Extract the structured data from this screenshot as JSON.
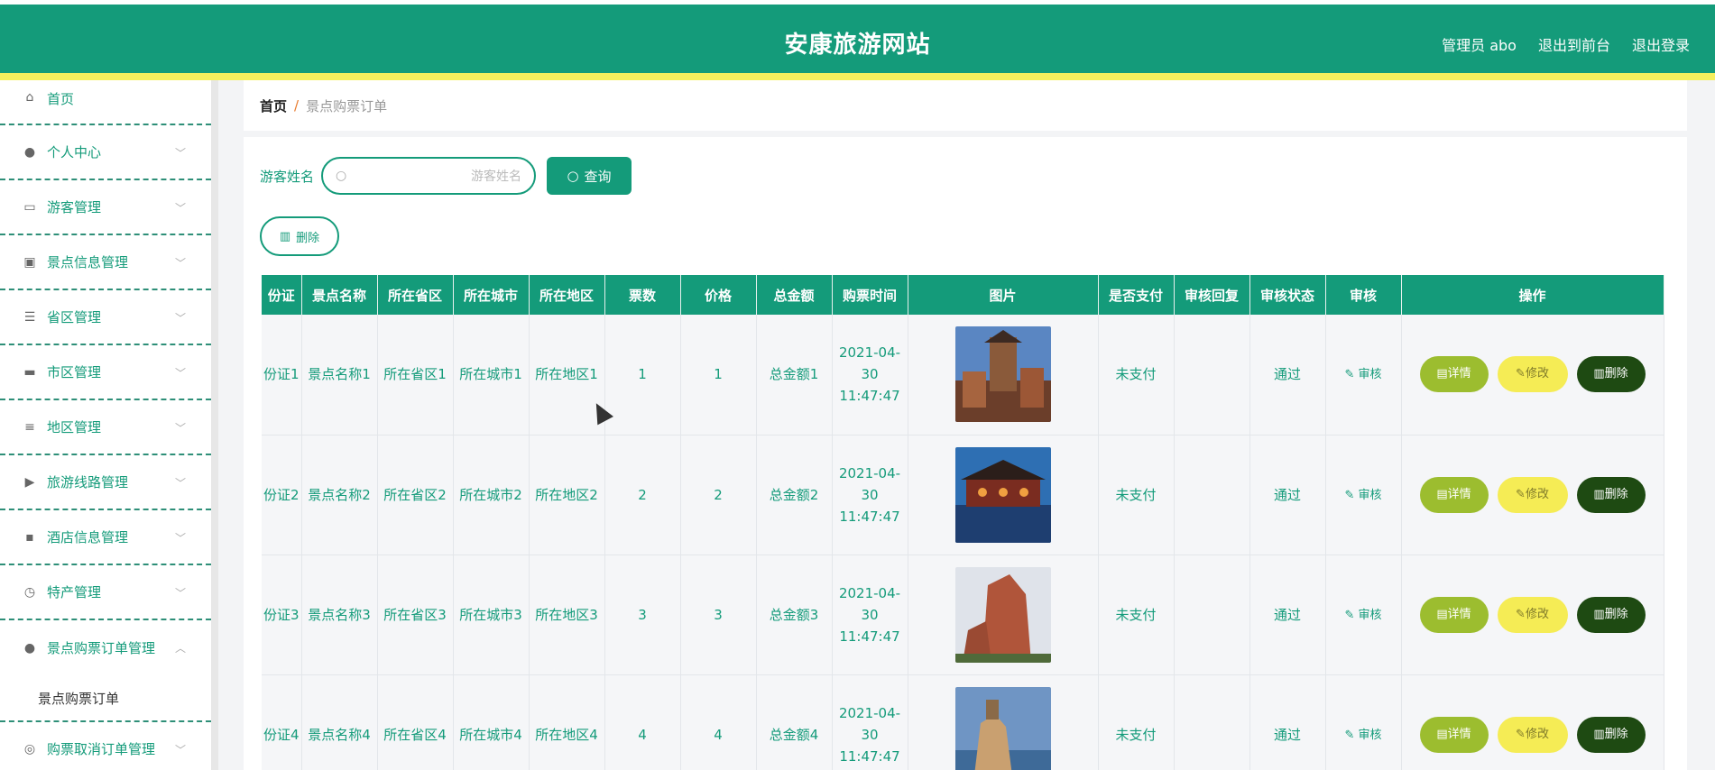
{
  "header": {
    "title": "安康旅游网站",
    "admin": "管理员 abo",
    "to_front": "退出到前台",
    "logout": "退出登录"
  },
  "sidebar": {
    "items": [
      {
        "label": "首页",
        "icon": "home-icon"
      },
      {
        "label": "个人中心",
        "icon": "user-icon"
      },
      {
        "label": "游客管理",
        "icon": "id-card-icon"
      },
      {
        "label": "景点信息管理",
        "icon": "clipboard-icon"
      },
      {
        "label": "省区管理",
        "icon": "list-icon"
      },
      {
        "label": "市区管理",
        "icon": "printer-icon"
      },
      {
        "label": "地区管理",
        "icon": "sliders-icon"
      },
      {
        "label": "旅游线路管理",
        "icon": "camera-icon"
      },
      {
        "label": "酒店信息管理",
        "icon": "chat-icon"
      },
      {
        "label": "特产管理",
        "icon": "clock-icon"
      },
      {
        "label": "景点购票订单管理",
        "icon": "user-icon"
      },
      {
        "label": "购票取消订单管理",
        "icon": "compass-icon"
      }
    ],
    "sub_active": "景点购票订单"
  },
  "breadcrumb": {
    "home": "首页",
    "sep": "/",
    "current": "景点购票订单"
  },
  "search": {
    "label": "游客姓名",
    "placeholder": "游客姓名",
    "button": "查询"
  },
  "toolbar": {
    "delete": "删除"
  },
  "table": {
    "headers": [
      "份证",
      "景点名称",
      "所在省区",
      "所在城市",
      "所在地区",
      "票数",
      "价格",
      "总金额",
      "购票时间",
      "图片",
      "是否支付",
      "审核回复",
      "审核状态",
      "审核",
      "操作"
    ],
    "rows": [
      {
        "id": "份证1",
        "name": "景点名称1",
        "province": "所在省区1",
        "city": "所在城市1",
        "area": "所在地区1",
        "tickets": "1",
        "price": "1",
        "total": "总金额1",
        "time": "2021-04-30 11:47:47",
        "paid": "未支付",
        "reply": "",
        "status": "通过"
      },
      {
        "id": "份证2",
        "name": "景点名称2",
        "province": "所在省区2",
        "city": "所在城市2",
        "area": "所在地区2",
        "tickets": "2",
        "price": "2",
        "total": "总金额2",
        "time": "2021-04-30 11:47:47",
        "paid": "未支付",
        "reply": "",
        "status": "通过"
      },
      {
        "id": "份证3",
        "name": "景点名称3",
        "province": "所在省区3",
        "city": "所在城市3",
        "area": "所在地区3",
        "tickets": "3",
        "price": "3",
        "total": "总金额3",
        "time": "2021-04-30 11:47:47",
        "paid": "未支付",
        "reply": "",
        "status": "通过"
      },
      {
        "id": "份证4",
        "name": "景点名称4",
        "province": "所在省区4",
        "city": "所在城市4",
        "area": "所在地区4",
        "tickets": "4",
        "price": "4",
        "total": "总金额4",
        "time": "2021-04-30 11:47:47",
        "paid": "未支付",
        "reply": "",
        "status": "通过"
      }
    ],
    "actions": {
      "audit": "审核",
      "detail": "详情",
      "edit": "修改",
      "delete": "删除"
    }
  },
  "colors": {
    "primary": "#149b7a",
    "accent_bar": "#f5ef5d",
    "detail": "#9cbd2f",
    "edit": "#f5ec55",
    "delete": "#1e4a12"
  }
}
